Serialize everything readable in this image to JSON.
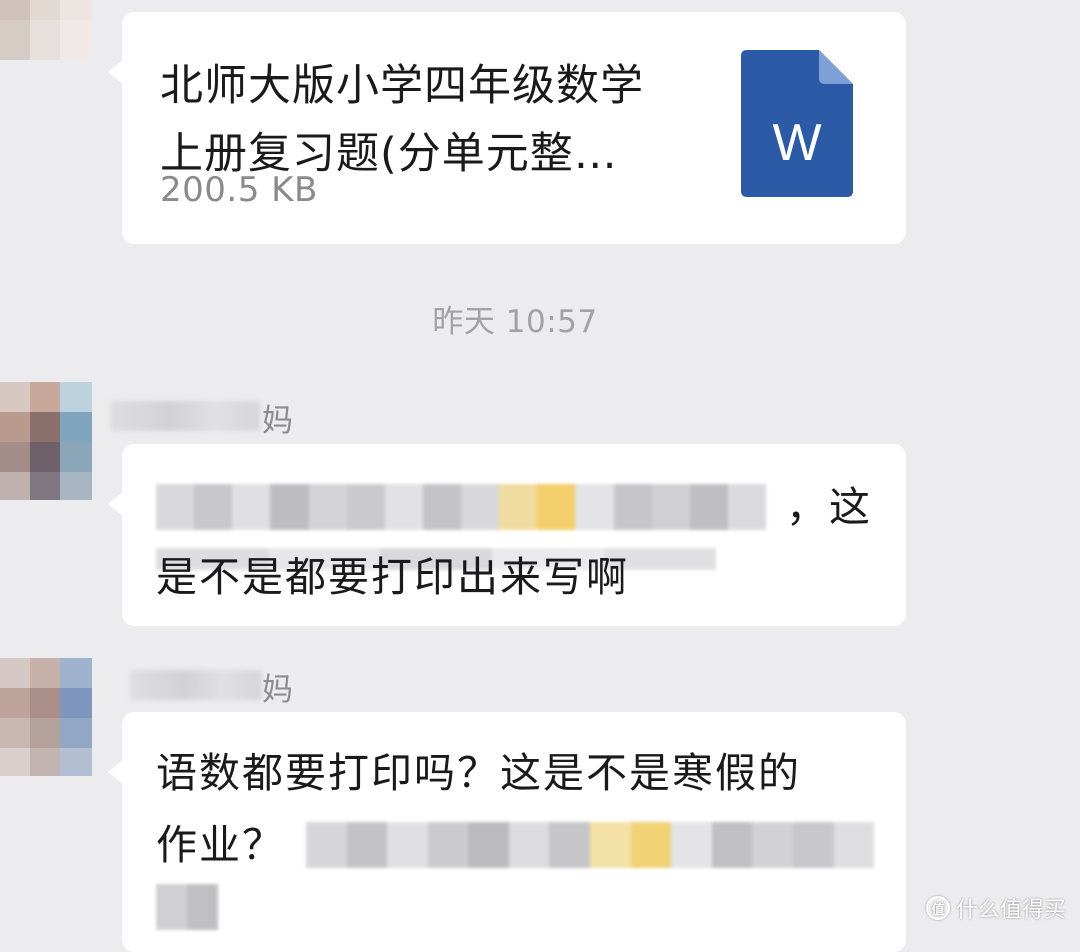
{
  "file_message": {
    "title": "北师大版小学四年级数学\n上册复习题(分单元整…",
    "size": "200.5 KB",
    "icon": "word-document-icon",
    "icon_letter": "W",
    "icon_color": "#2b5ba7"
  },
  "timestamp": "昨天 10:57",
  "messages": [
    {
      "sender_suffix": "妈",
      "line1_tail": "，这",
      "line2": "是不是都要打印出来写啊"
    },
    {
      "sender_suffix": "妈",
      "line1": "语数都要打印吗？这是不是寒假的",
      "line2_head": "作业？"
    }
  ],
  "watermark": {
    "icon_text": "值",
    "text": "什么值得买"
  },
  "colors": {
    "background": "#ececef",
    "bubble": "#ffffff",
    "text": "#1a1a1a",
    "meta_text": "#8a8a8a"
  }
}
